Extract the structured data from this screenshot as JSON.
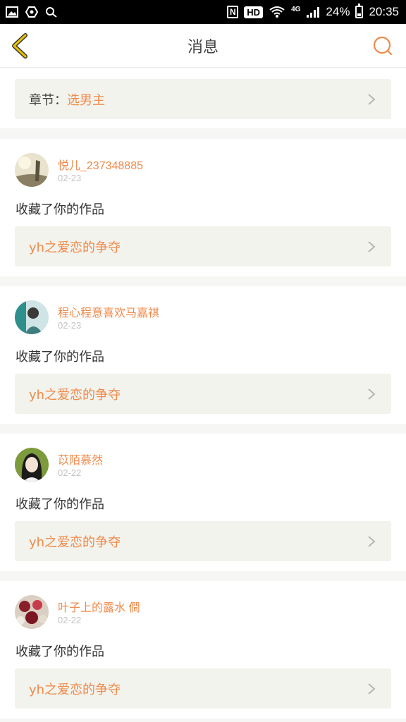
{
  "status_bar": {
    "network": "4G",
    "battery": "24%",
    "time": "20:35",
    "hd": "HD",
    "nfc": "N"
  },
  "header": {
    "title": "消息",
    "back_icon": "chevron-left-icon",
    "search_icon": "search-icon"
  },
  "chapter": {
    "label": "章节：",
    "value": "选男主"
  },
  "messages": [
    {
      "username": "悦儿_237348885",
      "date": "02-23",
      "action": "收藏了你的作品",
      "work_title": "yh之爱恋的争夺"
    },
    {
      "username": "程心程意喜欢马嘉祺",
      "date": "02-23",
      "action": "收藏了你的作品",
      "work_title": "yh之爱恋的争夺"
    },
    {
      "username": "苡陌慕然",
      "date": "02-22",
      "action": "收藏了你的作品",
      "work_title": "yh之爱恋的争夺"
    },
    {
      "username": "叶子上的露水 僴",
      "date": "02-22",
      "action": "收藏了你的作品",
      "work_title": "yh之爱恋的争夺"
    }
  ],
  "colors": {
    "accent": "#ef8a4b",
    "back_icon": "#e8b400",
    "card_bg": "#f3f3ed"
  }
}
